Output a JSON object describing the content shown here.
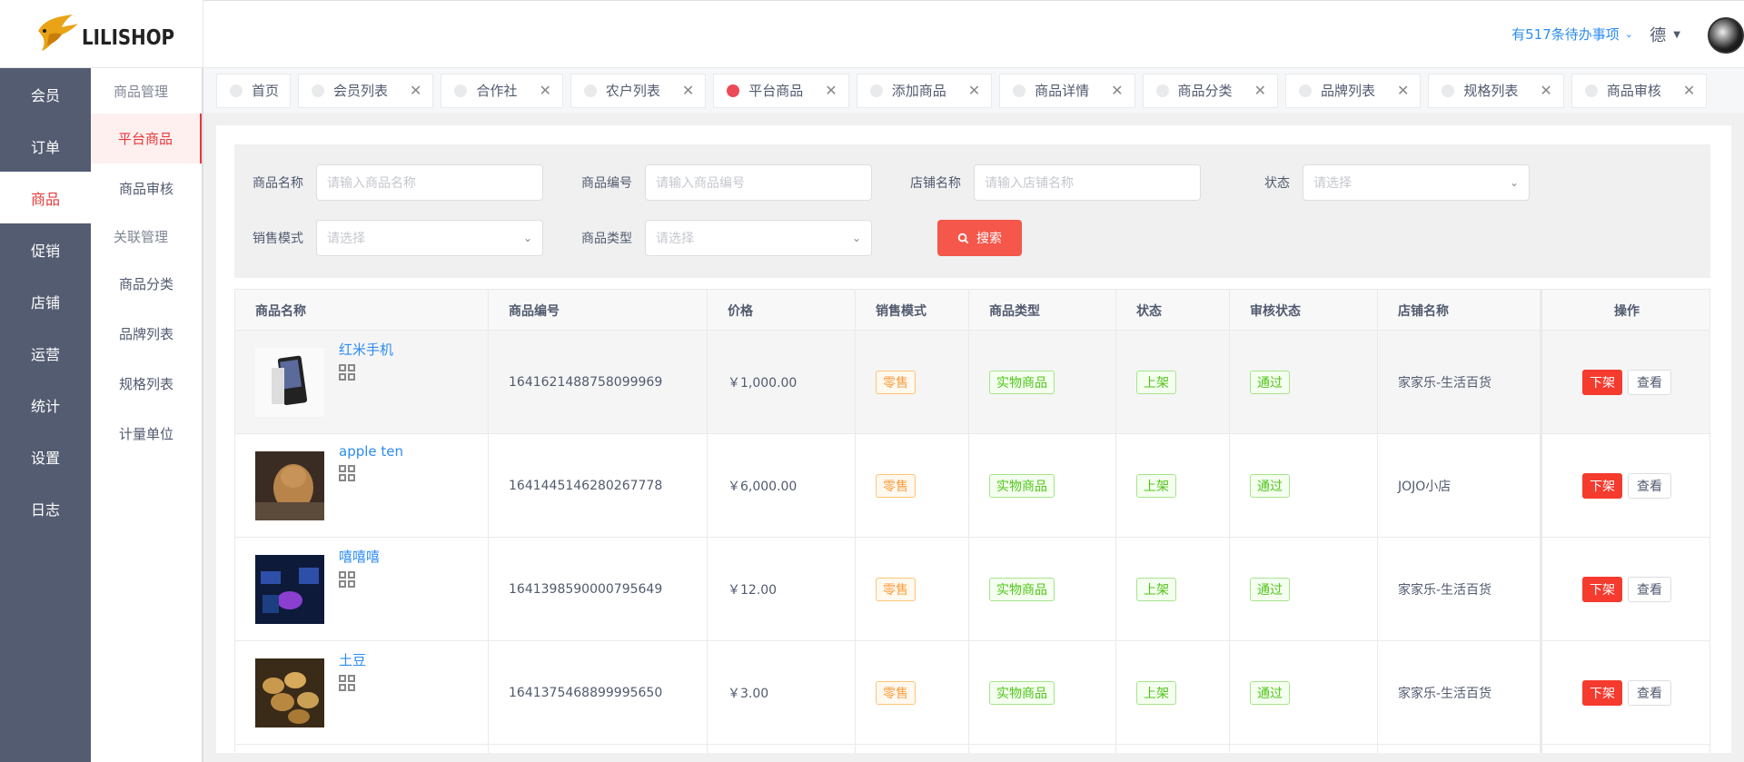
{
  "brand": {
    "name": "LILISHOP"
  },
  "header": {
    "todo_text": "有517条待办事项",
    "user_name": "德"
  },
  "side_main": [
    {
      "label": "会员"
    },
    {
      "label": "订单"
    },
    {
      "label": "商品",
      "active": true
    },
    {
      "label": "促销"
    },
    {
      "label": "店铺"
    },
    {
      "label": "运营"
    },
    {
      "label": "统计"
    },
    {
      "label": "设置"
    },
    {
      "label": "日志"
    }
  ],
  "side_sub": {
    "group1": "商品管理",
    "item_platform": "平台商品",
    "item_audit": "商品审核",
    "group2": "关联管理",
    "item_category": "商品分类",
    "item_brand": "品牌列表",
    "item_spec": "规格列表",
    "item_unit": "计量单位"
  },
  "tabs": [
    {
      "label": "首页"
    },
    {
      "label": "会员列表"
    },
    {
      "label": "合作社"
    },
    {
      "label": "农户列表"
    },
    {
      "label": "平台商品",
      "active": true
    },
    {
      "label": "添加商品"
    },
    {
      "label": "商品详情"
    },
    {
      "label": "商品分类"
    },
    {
      "label": "品牌列表"
    },
    {
      "label": "规格列表"
    },
    {
      "label": "商品审核"
    }
  ],
  "search": {
    "name_label": "商品名称",
    "name_placeholder": "请输入商品名称",
    "code_label": "商品编号",
    "code_placeholder": "请输入商品编号",
    "shop_label": "店铺名称",
    "shop_placeholder": "请输入店铺名称",
    "status_label": "状态",
    "status_placeholder": "请选择",
    "sale_label": "销售模式",
    "sale_placeholder": "请选择",
    "type_label": "商品类型",
    "type_placeholder": "请选择",
    "button": "搜索"
  },
  "table": {
    "headers": [
      "商品名称",
      "商品编号",
      "价格",
      "销售模式",
      "商品类型",
      "状态",
      "审核状态",
      "店铺名称",
      "操作"
    ],
    "rows": [
      {
        "name": "红米手机",
        "code": "1641621488758099969",
        "price": "￥1,000.00",
        "sale_mode": "零售",
        "type": "实物商品",
        "status": "上架",
        "audit": "通过",
        "shop": "家家乐-生活百货",
        "btn_off": "下架",
        "btn_view": "查看"
      },
      {
        "name": "apple ten",
        "code": "1641445146280267778",
        "price": "￥6,000.00",
        "sale_mode": "零售",
        "type": "实物商品",
        "status": "上架",
        "audit": "通过",
        "shop": "JOJO小店",
        "btn_off": "下架",
        "btn_view": "查看"
      },
      {
        "name": "嘻嘻嘻",
        "code": "1641398590000795649",
        "price": "￥12.00",
        "sale_mode": "零售",
        "type": "实物商品",
        "status": "上架",
        "audit": "通过",
        "shop": "家家乐-生活百货",
        "btn_off": "下架",
        "btn_view": "查看"
      },
      {
        "name": "土豆",
        "code": "1641375468899995650",
        "price": "￥3.00",
        "sale_mode": "零售",
        "type": "实物商品",
        "status": "上架",
        "audit": "通过",
        "shop": "家家乐-生活百货",
        "btn_off": "下架",
        "btn_view": "查看"
      }
    ]
  },
  "colors": {
    "accent": "#e4393c",
    "sidebar": "#545c71",
    "link": "#2d8cf0",
    "danger": "#f53a2e"
  }
}
